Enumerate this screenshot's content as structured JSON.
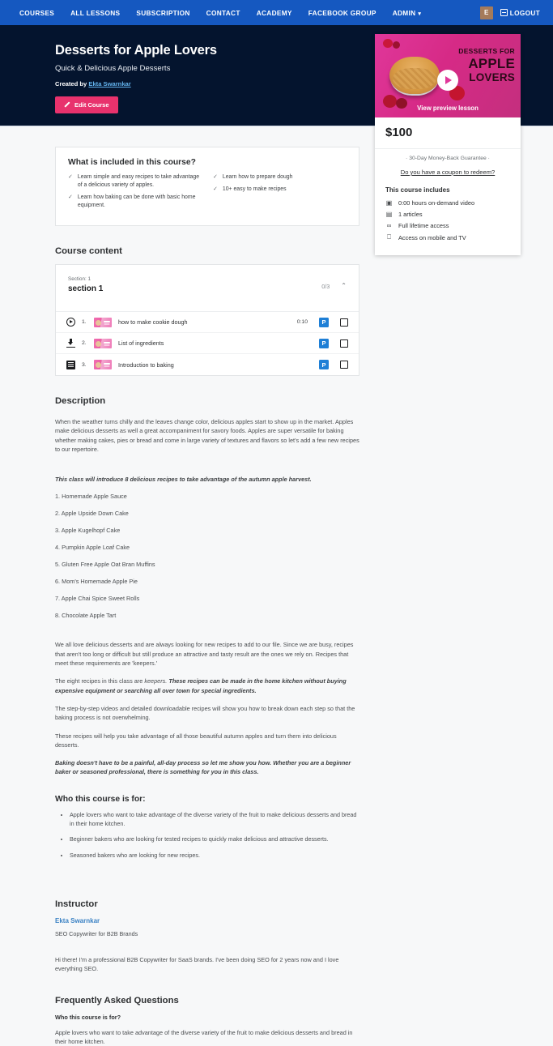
{
  "navbar": {
    "links": [
      {
        "label": "COURSES"
      },
      {
        "label": "ALL LESSONS"
      },
      {
        "label": "SUBSCRIPTION"
      },
      {
        "label": "CONTACT"
      },
      {
        "label": "ACADEMY"
      },
      {
        "label": "FACEBOOK GROUP"
      },
      {
        "label": "ADMIN",
        "caret": "▾"
      }
    ],
    "avatar_initial": "E",
    "logout_label": "LOGOUT",
    "bg_color": "#1558c0"
  },
  "hero": {
    "title": "Desserts for Apple Lovers",
    "subtitle": "Quick & Delicious Apple Desserts",
    "created_by_label": "Created by",
    "author": "Ekta Swarnkar",
    "edit_button": "Edit Course",
    "bg_color": "#04142e",
    "accent_color": "#e8326d"
  },
  "side_card": {
    "thumb_line1": "DESSERTS FOR",
    "thumb_line2": "APPLE",
    "thumb_line3": "LOVERS",
    "preview_label": "View preview lesson",
    "price": "$100",
    "guarantee": "· 30-Day Money-Back Guarantee ·",
    "coupon_link": "Do you have a coupon to redeem?",
    "includes_title": "This course includes",
    "includes": [
      {
        "icon": "video-icon",
        "glyph": "▣",
        "label": "0:00 hours on-demand video"
      },
      {
        "icon": "article-icon",
        "glyph": "▤",
        "label": "1 articles"
      },
      {
        "icon": "infinity-icon",
        "glyph": "∞",
        "label": "Full lifetime access"
      },
      {
        "icon": "mobile-icon",
        "glyph": "⎕",
        "label": "Access on mobile and TV"
      }
    ]
  },
  "included_box": {
    "title": "What is included in this course?",
    "column1": [
      "Learn simple and easy recipes to take advantage of a delicious variety of apples.",
      "Learn how baking can be done with basic home equipment."
    ],
    "column2": [
      "Learn how to prepare dough",
      "10+ easy to make recipes"
    ],
    "check_glyph": "✓"
  },
  "course_content": {
    "title": "Course content",
    "section_eyebrow": "Section: 1",
    "section_name": "section 1",
    "progress": "0/3",
    "chevron": "⌃",
    "lessons": [
      {
        "type": "play-icon",
        "num": "1.",
        "name": "how to make cookie dough",
        "duration": "0:10",
        "badge": "P"
      },
      {
        "type": "download-icon",
        "num": "2.",
        "name": "List of ingredients",
        "duration": "",
        "badge": "P"
      },
      {
        "type": "document-icon",
        "num": "3.",
        "name": "Introduction to baking",
        "duration": "",
        "badge": "P"
      }
    ]
  },
  "description": {
    "title": "Description",
    "para1": "When the weather turns chilly and the leaves change color, delicious apples start to show up in the market. Apples make delicious desserts as well a great accompaniment for savory foods. Apples are super versatile for baking whether making cakes, pies or bread and come in large variety of textures and flavors so let's add a few new recipes to our repertoire.",
    "intro_bold": "This class will introduce 8 delicious recipes to take advantage of the autumn apple harvest.",
    "recipes": [
      "1. Homemade Apple Sauce",
      "2. Apple Upside Down Cake",
      "3. Apple Kugelhopf Cake",
      "4. Pumpkin Apple Loaf Cake",
      "5. Gluten Free Apple Oat Bran Muffins",
      "6. Mom's Homemade Apple Pie",
      "7. Apple Chai Spice Sweet Rolls",
      "8. Chocolate Apple Tart"
    ],
    "para2": "We all love delicious desserts and are always looking for new recipes to add to our file. Since we are busy, recipes that aren't too long or difficult but still produce an attractive and tasty result are the ones we rely on. Recipes that meet these requirements are 'keepers.'",
    "para3_a": "The eight recipes in this class are ",
    "para3_i": "keepers.",
    "para3_b": " These recipes can be made in the home kitchen without buying expensive equipment or searching all over town for special ingredients.",
    "para4": "The step-by-step videos and detailed downloadable recipes will show you how to break down each step so that the baking process is not overwhelming.",
    "para5": "These recipes will help you take advantage of all those beautiful autumn apples and turn them into delicious desserts.",
    "para6_bold": "Baking doesn't have to be a painful, all-day process so let me show you how. Whether you are a beginner baker or seasoned professional, there is something for you in this class."
  },
  "audience": {
    "title": "Who this course is for:",
    "items": [
      "Apple lovers who want to take advantage of the diverse variety of the fruit to make delicious desserts and bread in their home kitchen.",
      "Beginner bakers who are looking for tested recipes to quickly make delicious and attractive desserts.",
      "Seasoned bakers who are looking for new recipes."
    ]
  },
  "instructor": {
    "title": "Instructor",
    "name": "Ekta Swarnkar",
    "role": "SEO Copywriter for B2B Brands",
    "bio": "Hi there! I'm a professional B2B Copywriter for SaaS brands. I've been doing SEO for 2 years now and I love everything SEO."
  },
  "faq": {
    "title": "Frequently Asked Questions",
    "question": "Who this course is for?",
    "answer": "Apple lovers who want to take advantage of the diverse variety of the fruit to make delicious desserts and bread in their home kitchen."
  }
}
